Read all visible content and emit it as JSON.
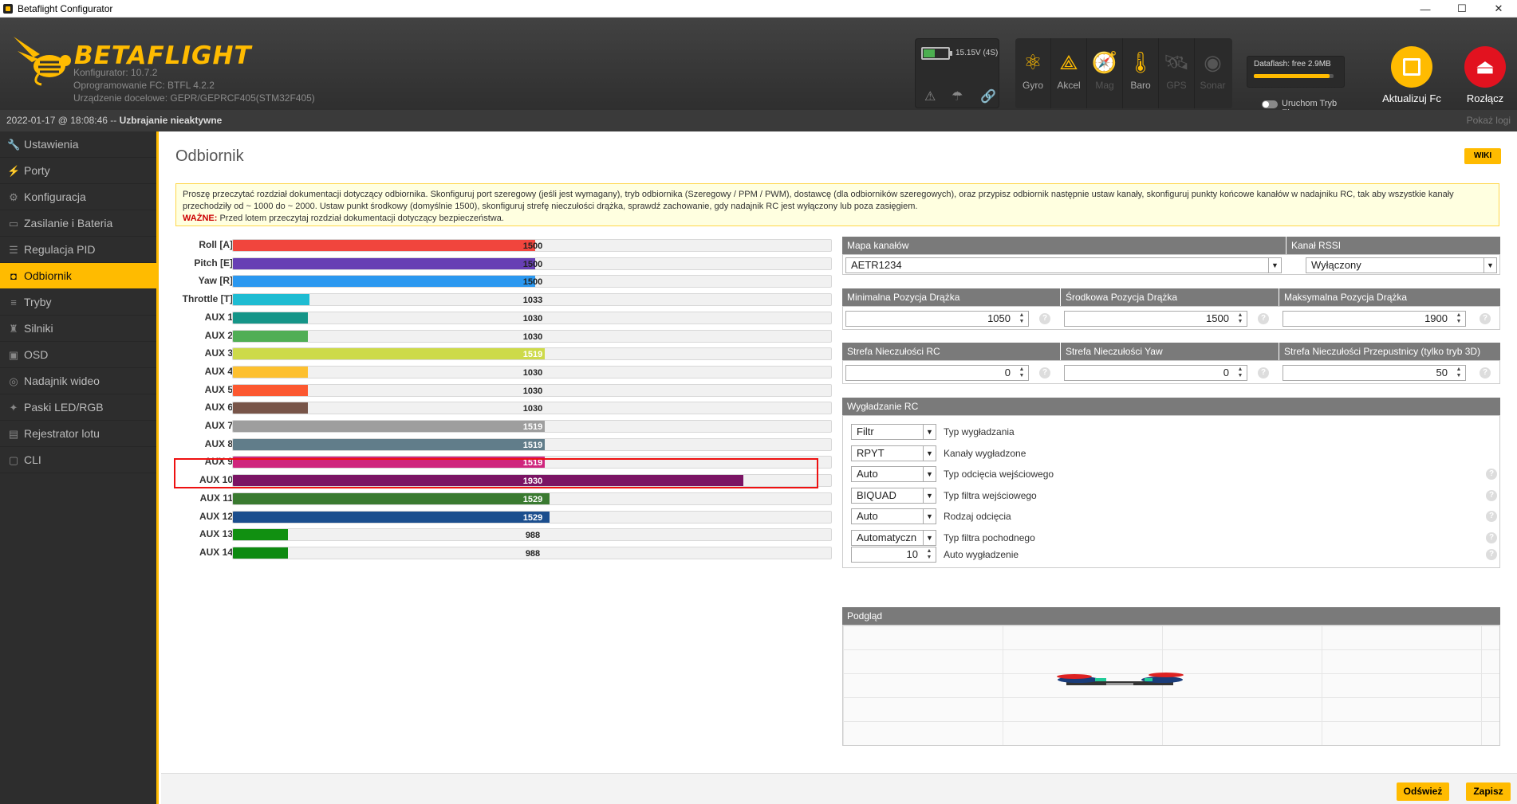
{
  "window": {
    "title": "Betaflight Configurator",
    "controls": [
      "—",
      "☐",
      "✕"
    ]
  },
  "header": {
    "logo": "BETAFLIGHT",
    "configurator": "Konfigurator: 10.7.2",
    "firmware": "Oprogramowanie FC: BTFL 4.2.2",
    "target": "Urządzenie docelowe: GEPR/GEPRCF405(STM32F405)",
    "battery": "15.15V (4S)",
    "sensors": [
      {
        "label": "Gyro",
        "icon": "gyro-icon",
        "active": true
      },
      {
        "label": "Akcel",
        "icon": "accel-icon",
        "active": true
      },
      {
        "label": "Mag",
        "icon": "mag-icon",
        "active": false
      },
      {
        "label": "Baro",
        "icon": "baro-icon",
        "active": true
      },
      {
        "label": "GPS",
        "icon": "gps-icon",
        "active": false
      },
      {
        "label": "Sonar",
        "icon": "sonar-icon",
        "active": false
      }
    ],
    "dataflash": "Dataflash: free 2.9MB",
    "dataflash_used": 0.95,
    "expert_mode": "Uruchom Tryb Eksperta",
    "update_label": "Aktualizuj Fc",
    "disconnect_label": "Rozłącz"
  },
  "status": {
    "datetime": "2022-01-17 @ 18:08:46 --",
    "arming": "Uzbrajanie nieaktywne",
    "show_log": "Pokaż logi"
  },
  "sidebar": {
    "items": [
      {
        "label": "Ustawienia",
        "icon": "wrench-icon",
        "glyph": "🔧",
        "active": false
      },
      {
        "label": "Porty",
        "icon": "plug-icon",
        "glyph": "⚡",
        "active": false
      },
      {
        "label": "Konfiguracja",
        "icon": "gear-icon",
        "glyph": "⚙",
        "active": false
      },
      {
        "label": "Zasilanie i Bateria",
        "icon": "battery-icon",
        "glyph": "▭",
        "active": false
      },
      {
        "label": "Regulacja PID",
        "icon": "sliders-icon",
        "glyph": "☰",
        "active": false
      },
      {
        "label": "Odbiornik",
        "icon": "gamepad-icon",
        "glyph": "◘",
        "active": true
      },
      {
        "label": "Tryby",
        "icon": "modes-icon",
        "glyph": "≡",
        "active": false
      },
      {
        "label": "Silniki",
        "icon": "motor-icon",
        "glyph": "♜",
        "active": false
      },
      {
        "label": "OSD",
        "icon": "osd-icon",
        "glyph": "▣",
        "active": false
      },
      {
        "label": "Nadajnik wideo",
        "icon": "antenna-icon",
        "glyph": "◎",
        "active": false
      },
      {
        "label": "Paski LED/RGB",
        "icon": "led-icon",
        "glyph": "✦",
        "active": false
      },
      {
        "label": "Rejestrator lotu",
        "icon": "blackbox-icon",
        "glyph": "▤",
        "active": false
      },
      {
        "label": "CLI",
        "icon": "terminal-icon",
        "glyph": "▢",
        "active": false
      }
    ]
  },
  "main": {
    "title": "Odbiornik",
    "wiki": "WIKI",
    "notice": "Proszę przeczytać rozdział dokumentacji dotyczący odbiornika. Skonfiguruj port szeregowy (jeśli jest wymagany), tryb odbiornika (Szeregowy / PPM / PWM), dostawcę (dla odbiorników szeregowych), oraz przypisz odbiornik następnie ustaw kanały, skonfiguruj punkty końcowe kanałów w nadajniku RC, tak aby wszystkie kanały przechodziły od ~ 1000 do ~ 2000. Ustaw punkt środkowy (domyślnie 1500), skonfiguruj strefę nieczułości drążka, sprawdź zachowanie, gdy nadajnik RC jest wyłączony lub poza zasięgiem.",
    "notice_important_label": "WAŻNE:",
    "notice_important": " Przed lotem przeczytaj rozdział dokumentacji dotyczący bezpieczeństwa.",
    "refresh": "Odśwież",
    "save": "Zapisz"
  },
  "channels": [
    {
      "name": "Roll [A]",
      "value": 1500,
      "color": "#f1453d"
    },
    {
      "name": "Pitch [E]",
      "value": 1500,
      "color": "#673fb4"
    },
    {
      "name": "Yaw [R]",
      "value": 1500,
      "color": "#2b98f0"
    },
    {
      "name": "Throttle [T]",
      "value": 1033,
      "color": "#1fbcd2"
    },
    {
      "name": "AUX 1",
      "value": 1030,
      "color": "#159588"
    },
    {
      "name": "AUX 2",
      "value": 1030,
      "color": "#50ae55"
    },
    {
      "name": "AUX 3",
      "value": 1519,
      "color": "#cdda49"
    },
    {
      "name": "AUX 4",
      "value": 1030,
      "color": "#fdc02f"
    },
    {
      "name": "AUX 5",
      "value": 1030,
      "color": "#fc5830"
    },
    {
      "name": "AUX 6",
      "value": 1030,
      "color": "#785549"
    },
    {
      "name": "AUX 7",
      "value": 1519,
      "color": "#9e9e9e"
    },
    {
      "name": "AUX 8",
      "value": 1519,
      "color": "#617d8a"
    },
    {
      "name": "AUX 9",
      "value": 1519,
      "color": "#cf267d"
    },
    {
      "name": "AUX 10",
      "value": 1930,
      "color": "#7a1464"
    },
    {
      "name": "AUX 11",
      "value": 1529,
      "color": "#3a7a30"
    },
    {
      "name": "AUX 12",
      "value": 1529,
      "color": "#1b4e8e"
    },
    {
      "name": "AUX 13",
      "value": 988,
      "color": "#119011"
    },
    {
      "name": "AUX 14",
      "value": 988,
      "color": "#0d8a10"
    }
  ],
  "channel_range": [
    875,
    2115
  ],
  "settings": {
    "channel_map_label": "Mapa kanałów",
    "channel_map_value": "AETR1234",
    "rssi_label": "Kanał RSSI",
    "rssi_value": "Wyłączony",
    "min_label": "Minimalna Pozycja Drążka",
    "min_value": "1050",
    "mid_label": "Środkowa Pozycja Drążka",
    "mid_value": "1500",
    "max_label": "Maksymalna Pozycja Drążka",
    "max_value": "1900",
    "dz_rc_label": "Strefa Nieczułości RC",
    "dz_rc_value": "0",
    "dz_yaw_label": "Strefa Nieczułości Yaw",
    "dz_yaw_value": "0",
    "dz_thr_label": "Strefa Nieczułości Przepustnicy (tylko tryb 3D)",
    "dz_thr_value": "50"
  },
  "smoothing": {
    "title": "Wygładzanie RC",
    "rows": [
      {
        "value": "Filtr",
        "label": "Typ wygładzania",
        "help": false
      },
      {
        "value": "RPYT",
        "label": "Kanały wygładzone",
        "help": false
      },
      {
        "value": "Auto",
        "label": "Typ odcięcia wejściowego",
        "help": true
      },
      {
        "value": "BIQUAD",
        "label": "Typ filtra wejściowego",
        "help": true
      },
      {
        "value": "Auto",
        "label": "Rodzaj odcięcia",
        "help": true
      },
      {
        "value": "Automatyczn",
        "label": "Typ filtra pochodnego",
        "help": true
      }
    ],
    "auto_value": "10",
    "auto_label": "Auto wygładzenie"
  },
  "preview": {
    "title": "Podgląd"
  }
}
